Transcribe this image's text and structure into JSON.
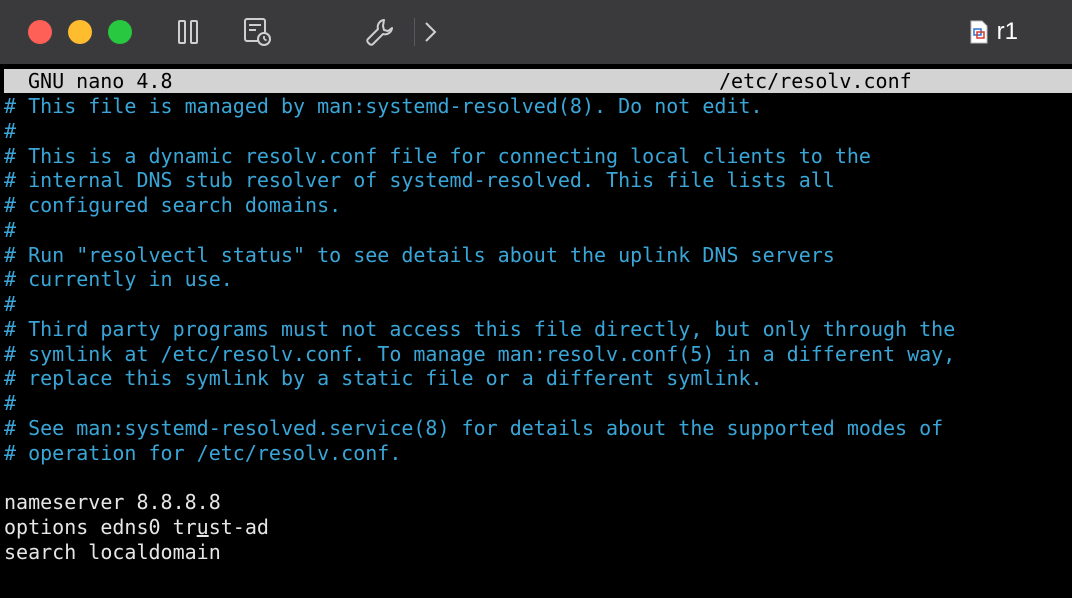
{
  "window": {
    "vm_name": "r1",
    "icons": {
      "pause": "pause-icon",
      "snapshot": "snapshot-icon",
      "settings": "wrench-icon",
      "forward": "chevron-right-icon",
      "vm": "vm-window-icon"
    },
    "colors": {
      "titlebar": "#3a3a3c",
      "close": "#fe5f57",
      "minimize": "#febc2e",
      "zoom": "#28c840"
    }
  },
  "nano": {
    "version": "GNU nano 4.8",
    "filename": "/etc/resolv.conf",
    "colors": {
      "comment": "#3aa6d8",
      "text": "#e6e6e6",
      "header_bg": "#d3d3d3"
    },
    "lines": [
      {
        "text": "# This file is managed by man:systemd-resolved(8). Do not edit.",
        "kind": "comment"
      },
      {
        "text": "#",
        "kind": "comment"
      },
      {
        "text": "# This is a dynamic resolv.conf file for connecting local clients to the",
        "kind": "comment"
      },
      {
        "text": "# internal DNS stub resolver of systemd-resolved. This file lists all",
        "kind": "comment"
      },
      {
        "text": "# configured search domains.",
        "kind": "comment"
      },
      {
        "text": "#",
        "kind": "comment"
      },
      {
        "text": "# Run \"resolvectl status\" to see details about the uplink DNS servers",
        "kind": "comment"
      },
      {
        "text": "# currently in use.",
        "kind": "comment"
      },
      {
        "text": "#",
        "kind": "comment"
      },
      {
        "text": "# Third party programs must not access this file directly, but only through the",
        "kind": "comment"
      },
      {
        "text": "# symlink at /etc/resolv.conf. To manage man:resolv.conf(5) in a different way,",
        "kind": "comment"
      },
      {
        "text": "# replace this symlink by a static file or a different symlink.",
        "kind": "comment"
      },
      {
        "text": "#",
        "kind": "comment"
      },
      {
        "text": "# See man:systemd-resolved.service(8) for details about the supported modes of",
        "kind": "comment"
      },
      {
        "text": "# operation for /etc/resolv.conf.",
        "kind": "comment"
      },
      {
        "text": "",
        "kind": "code"
      },
      {
        "text": "nameserver 8.8.8.8",
        "kind": "code"
      },
      {
        "text": "options edns0 trust-ad",
        "kind": "code",
        "cursor_col": 16
      },
      {
        "text": "search localdomain",
        "kind": "code"
      }
    ]
  }
}
